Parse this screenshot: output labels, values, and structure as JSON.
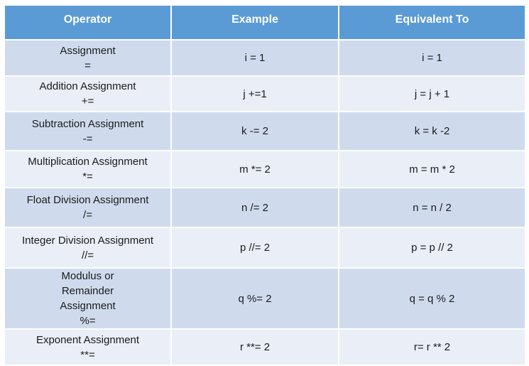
{
  "table": {
    "headers": [
      "Operator",
      "Example",
      "Equivalent To"
    ],
    "rows": [
      {
        "operator_name": "Assignment",
        "operator_symbol": "=",
        "example": "i = 1",
        "equivalent": "i = 1"
      },
      {
        "operator_name": "Addition Assignment",
        "operator_symbol": "+=",
        "example": "j +=1",
        "equivalent": "j = j + 1"
      },
      {
        "operator_name": "Subtraction Assignment",
        "operator_symbol": "-=",
        "example": "k -= 2",
        "equivalent": "k = k -2"
      },
      {
        "operator_name": "Multiplication Assignment",
        "operator_symbol": "*=",
        "example": "m *= 2",
        "equivalent": "m =  m * 2"
      },
      {
        "operator_name": "Float Division Assignment",
        "operator_symbol": "/=",
        "example": "n /= 2",
        "equivalent": "n = n / 2"
      },
      {
        "operator_name": "Integer Division Assignment",
        "operator_symbol": "//=",
        "example": "p //= 2",
        "equivalent": "p = p // 2"
      },
      {
        "operator_name": "Modulus or Remainder Assignment",
        "operator_symbol": "%=",
        "example": "q %= 2",
        "equivalent": "q = q % 2"
      },
      {
        "operator_name": "Exponent Assignment",
        "operator_symbol": "**=",
        "example": "r **= 2",
        "equivalent": "r= r ** 2"
      }
    ]
  },
  "colors": {
    "header_bg": "#5b9bd5",
    "row_dark_bg": "#cfdbed",
    "row_light_bg": "#e9eef7"
  }
}
